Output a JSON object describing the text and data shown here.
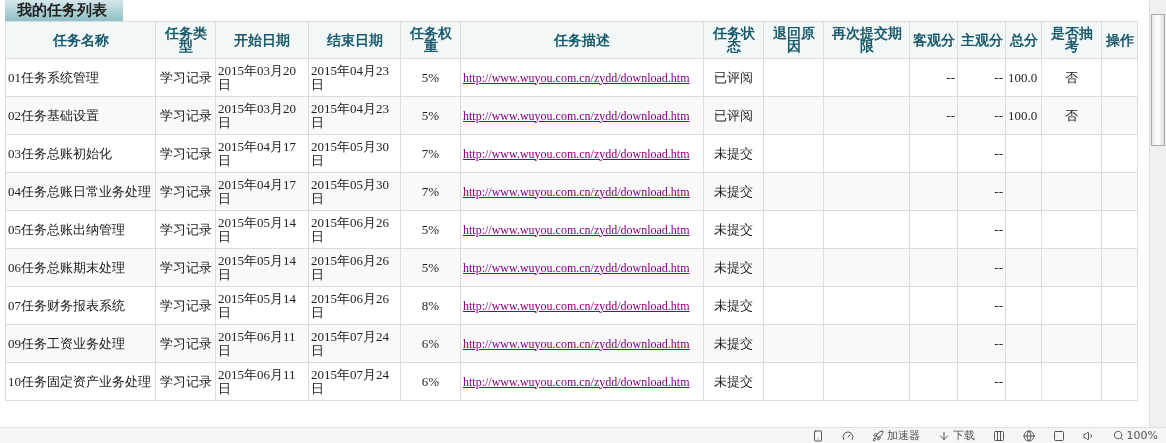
{
  "title": "我的任务列表",
  "columns": [
    "任务名称",
    "任务类型",
    "开始日期",
    "结束日期",
    "任务权重",
    "任务描述",
    "任务状态",
    "退回原因",
    "再次提交期限",
    "客观分",
    "主观分",
    "总分",
    "是否抽考",
    "操作"
  ],
  "rows": [
    {
      "name": "01任务系统管理",
      "type": "学习记录",
      "start": "2015年03月20日",
      "end": "2015年04月23日",
      "weight": "5%",
      "link": "http://www.wuyou.com.cn/zydd/download.htm",
      "status": "已评阅",
      "objective": "--",
      "subjective": "--",
      "total": "100.0",
      "draw": "否"
    },
    {
      "name": "02任务基础设置",
      "type": "学习记录",
      "start": "2015年03月20日",
      "end": "2015年04月23日",
      "weight": "5%",
      "link": "http://www.wuyou.com.cn/zydd/download.htm",
      "status": "已评阅",
      "objective": "--",
      "subjective": "--",
      "total": "100.0",
      "draw": "否"
    },
    {
      "name": "03任务总账初始化",
      "type": "学习记录",
      "start": "2015年04月17日",
      "end": "2015年05月30日",
      "weight": "7%",
      "link": "http://www.wuyou.com.cn/zydd/download.htm",
      "status": "未提交",
      "subjective": "--"
    },
    {
      "name": "04任务总账日常业务处理",
      "type": "学习记录",
      "start": "2015年04月17日",
      "end": "2015年05月30日",
      "weight": "7%",
      "link": "http://www.wuyou.com.cn/zydd/download.htm",
      "status": "未提交",
      "subjective": "--"
    },
    {
      "name": "05任务总账出纳管理",
      "type": "学习记录",
      "start": "2015年05月14日",
      "end": "2015年06月26日",
      "weight": "5%",
      "link": "http://www.wuyou.com.cn/zydd/download.htm",
      "status": "未提交",
      "subjective": "--"
    },
    {
      "name": "06任务总账期末处理",
      "type": "学习记录",
      "start": "2015年05月14日",
      "end": "2015年06月26日",
      "weight": "5%",
      "link": "http://www.wuyou.com.cn/zydd/download.htm",
      "status": "未提交",
      "subjective": "--"
    },
    {
      "name": "07任务财务报表系统",
      "type": "学习记录",
      "start": "2015年05月14日",
      "end": "2015年06月26日",
      "weight": "8%",
      "link": "http://www.wuyou.com.cn/zydd/download.htm",
      "status": "未提交",
      "subjective": "--"
    },
    {
      "name": "09任务工资业务处理",
      "type": "学习记录",
      "start": "2015年06月11日",
      "end": "2015年07月24日",
      "weight": "6%",
      "link": "http://www.wuyou.com.cn/zydd/download.htm",
      "status": "未提交",
      "subjective": "--"
    },
    {
      "name": "10任务固定资产业务处理",
      "type": "学习记录",
      "start": "2015年06月11日",
      "end": "2015年07月24日",
      "weight": "6%",
      "link": "http://www.wuyou.com.cn/zydd/download.htm",
      "status": "未提交",
      "subjective": "--"
    }
  ],
  "status_bar": {
    "accelerator": "加速器",
    "download": "下载",
    "zoom": "100%"
  }
}
